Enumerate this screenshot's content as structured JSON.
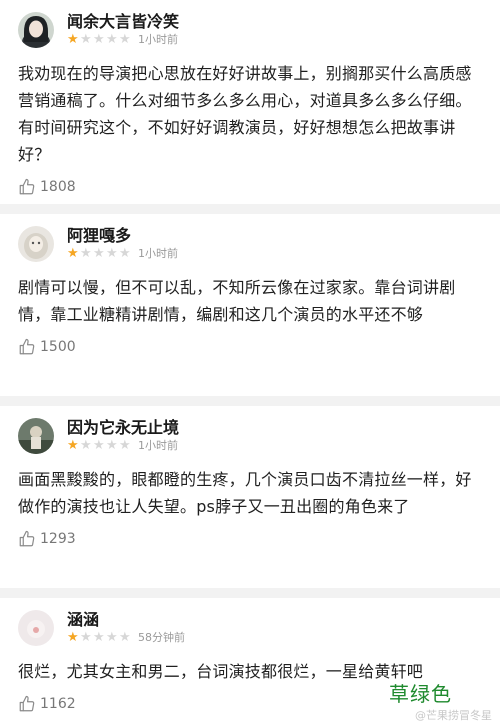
{
  "reviews": [
    {
      "username": "闻余大言皆冷笑",
      "rating": 1,
      "rating_max": 5,
      "time": "1小时前",
      "content": "我劝现在的导演把心思放在好好讲故事上，别搁那买什么高质感营销通稿了。什么对细节多么多么用心，对道具多么多么仔细。有时间研究这个，不如好好调教演员，好好想想怎么把故事讲好？",
      "likes": "1808"
    },
    {
      "username": "阿狸嘎多",
      "rating": 1,
      "rating_max": 5,
      "time": "1小时前",
      "content": "剧情可以慢，但不可以乱，不知所云像在过家家。靠台词讲剧情，靠工业糖精讲剧情，编剧和这几个演员的水平还不够",
      "likes": "1500"
    },
    {
      "username": "因为它永无止境",
      "rating": 1,
      "rating_max": 5,
      "time": "1小时前",
      "content": "画面黑黢黢的，眼都瞪的生疼，几个演员口齿不清拉丝一样，好做作的演技也让人失望。ps脖子又一丑出圈的角色来了",
      "likes": "1293"
    },
    {
      "username": "涵涵",
      "rating": 1,
      "rating_max": 5,
      "time": "58分钟前",
      "content": "很烂，尤其女主和男二，台词演技都很烂，一星给黄轩吧",
      "likes": "1162"
    }
  ],
  "overlay_text": "草绿色",
  "watermark": "@芒果捞冒冬星",
  "colors": {
    "star_on": "#f5a623",
    "star_off": "#d7d7d7",
    "overlay": "#1f8a2e"
  },
  "icons": {
    "like": "thumbs-up-icon",
    "star": "star-icon"
  }
}
